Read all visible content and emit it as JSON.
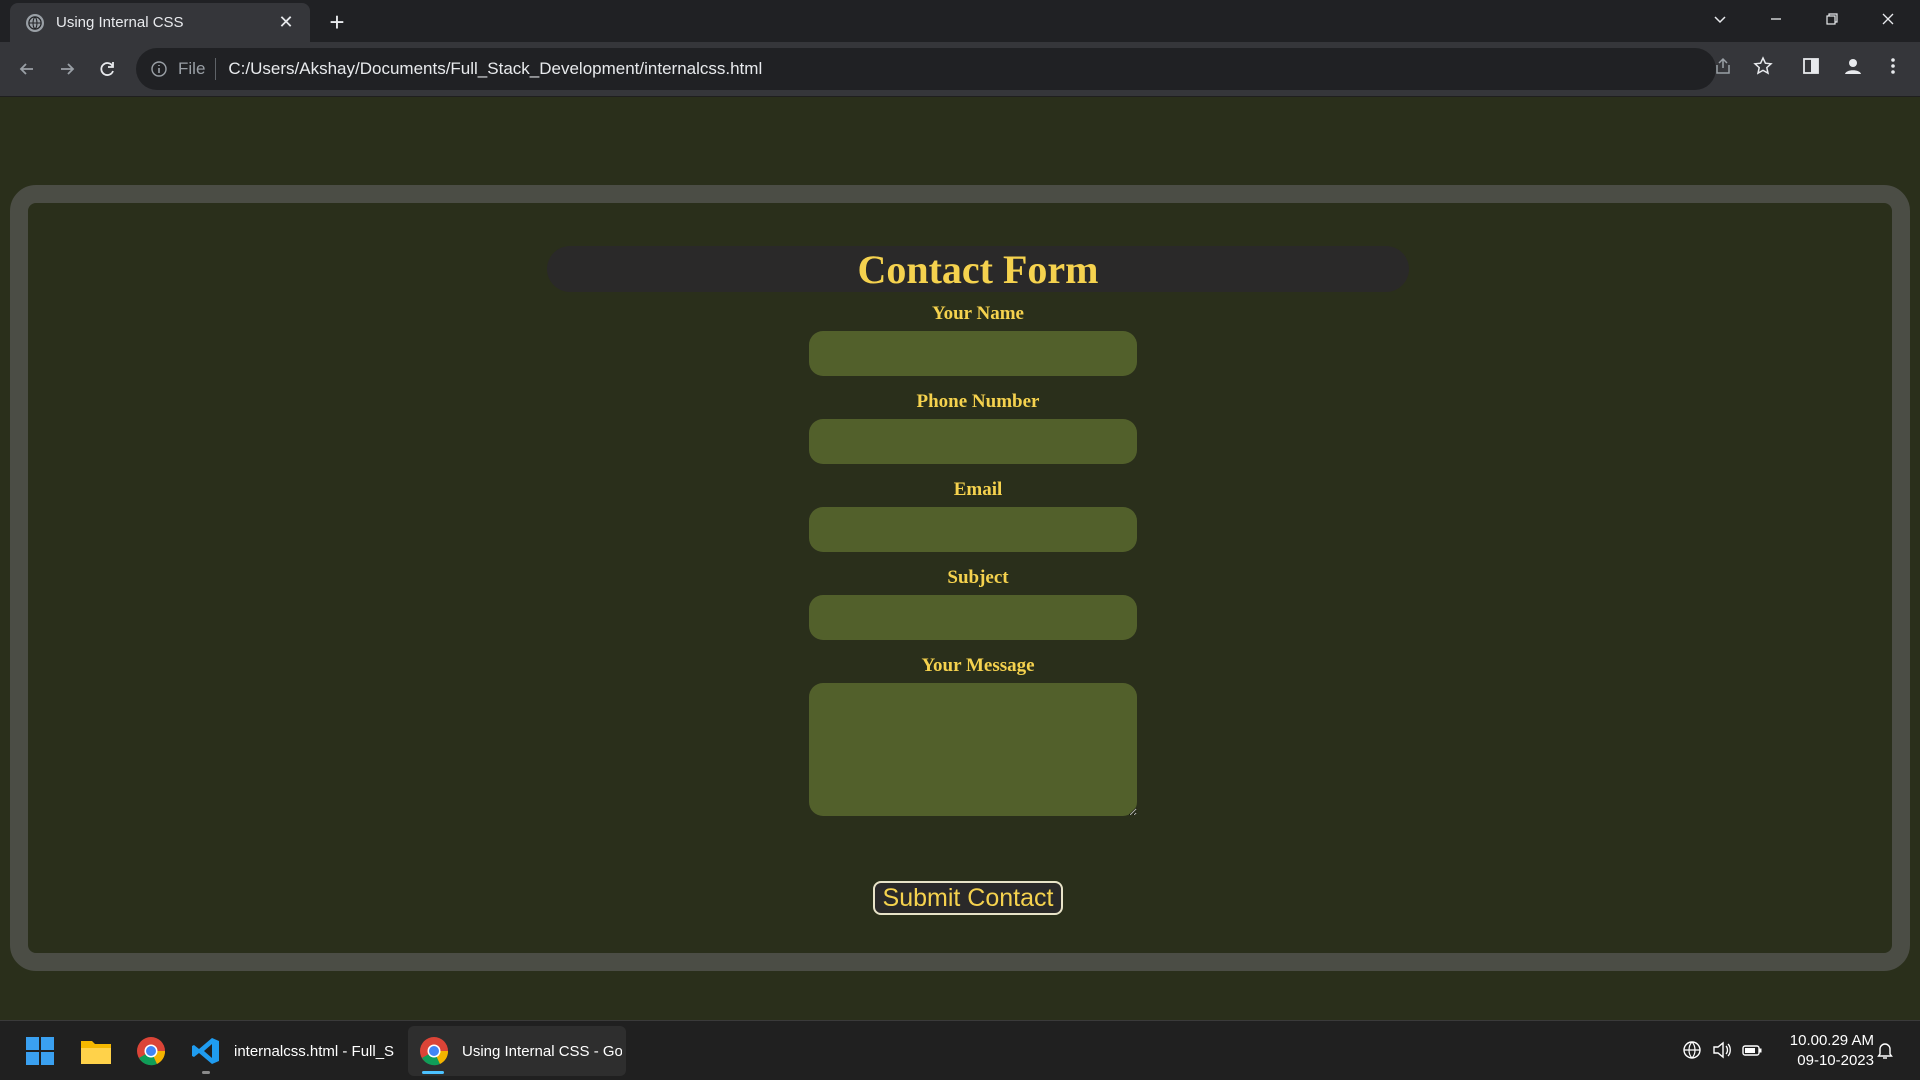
{
  "browser": {
    "tab_title": "Using Internal CSS",
    "new_tab_label": "+",
    "address": {
      "scheme_label": "File",
      "url": "C:/Users/Akshay/Documents/Full_Stack_Development/internalcss.html"
    }
  },
  "page": {
    "heading": "Contact Form",
    "fields": [
      {
        "label": "Your Name",
        "value": ""
      },
      {
        "label": "Phone Number",
        "value": ""
      },
      {
        "label": "Email",
        "value": ""
      },
      {
        "label": "Subject",
        "value": ""
      },
      {
        "label": "Your Message",
        "value": ""
      }
    ],
    "submit_label": "Submit Contact",
    "colors": {
      "background": "#2a2f1b",
      "frame_border": "#4b4d45",
      "heading_text": "#f5d24e",
      "input_fill": "#52602b",
      "heading_bar": "#2a2929"
    }
  },
  "taskbar": {
    "apps": [
      {
        "icon": "windows-start-icon"
      },
      {
        "icon": "file-explorer-icon"
      },
      {
        "icon": "chrome-icon"
      },
      {
        "icon": "vscode-icon",
        "label": "internalcss.html - Full_St"
      },
      {
        "icon": "chrome-icon",
        "label": "Using Internal CSS - Goo"
      }
    ],
    "time": "10.00.29 AM",
    "date": "09-10-2023"
  }
}
